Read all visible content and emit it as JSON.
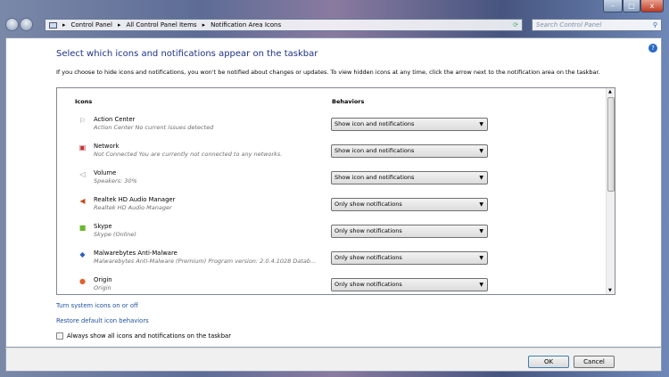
{
  "window": {
    "min": "–",
    "max": "□",
    "close": "x"
  },
  "address": {
    "crumbs": [
      "Control Panel",
      "All Control Panel Items",
      "Notification Area Icons"
    ],
    "search_placeholder": "Search Control Panel"
  },
  "main": {
    "title": "Select which icons and notifications appear on the taskbar",
    "intro": "If you choose to hide icons and notifications, you won't be notified about changes or updates. To view hidden icons at any time, click the arrow next to the notification area on the taskbar.",
    "col_icons": "Icons",
    "col_behaviors": "Behaviors",
    "rows": [
      {
        "name": "Action Center",
        "desc": "Action Center  No current issues detected",
        "behavior": "Show icon and notifications",
        "icon": "flag-icon",
        "color": "#888888"
      },
      {
        "name": "Network",
        "desc": "Not Connected You are currently not connected to any networks.",
        "behavior": "Show icon and notifications",
        "icon": "network-icon",
        "color": "#c03030"
      },
      {
        "name": "Volume",
        "desc": "Speakers: 30%",
        "behavior": "Show icon and notifications",
        "icon": "speaker-icon",
        "color": "#888888"
      },
      {
        "name": "Realtek HD Audio Manager",
        "desc": "Realtek HD Audio Manager",
        "behavior": "Only show notifications",
        "icon": "realtek-speaker-icon",
        "color": "#c05020"
      },
      {
        "name": "Skype",
        "desc": "Skype (Online)",
        "behavior": "Only show notifications",
        "icon": "skype-icon",
        "color": "#6ab82a"
      },
      {
        "name": "Malwarebytes Anti-Malware",
        "desc": "Malwarebytes Anti-Malware (Premium)  Program version: 2.0.4.1028 Datab...",
        "behavior": "Only show notifications",
        "icon": "malwarebytes-icon",
        "color": "#2b5fc0"
      },
      {
        "name": "Origin",
        "desc": "Origin",
        "behavior": "Only show notifications",
        "icon": "origin-icon",
        "color": "#e0602a"
      }
    ],
    "link_system": "Turn system icons on or off",
    "link_restore": "Restore default icon behaviors",
    "always_show": "Always show all icons and notifications on the taskbar"
  },
  "footer": {
    "ok": "OK",
    "cancel": "Cancel"
  }
}
